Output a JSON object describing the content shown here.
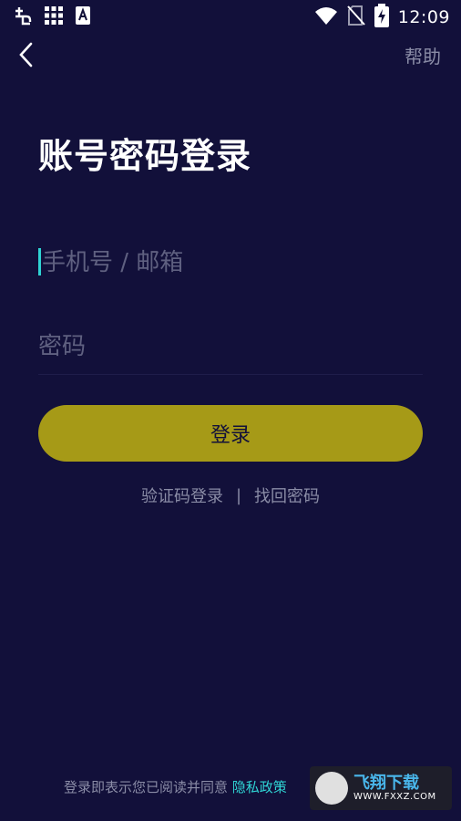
{
  "status_bar": {
    "time": "12:09",
    "icons": [
      "app-notification-icon",
      "grid-icon",
      "font-icon",
      "wifi-icon",
      "no-sim-icon",
      "battery-charging-icon"
    ]
  },
  "nav": {
    "back_icon": "chevron-left-icon",
    "help_label": "帮助"
  },
  "page": {
    "title": "账号密码登录"
  },
  "form": {
    "account_placeholder": "手机号 / 邮箱",
    "password_placeholder": "密码",
    "login_label": "登录"
  },
  "alt_links": {
    "sms_login": "验证码登录",
    "separator": "|",
    "recover_password": "找回密码"
  },
  "footer": {
    "agreement_text": "登录即表示您已阅读并同意",
    "privacy_link": "隐私政策"
  },
  "watermark": {
    "title": "飞翔下载",
    "url": "WWW.FXXZ.COM"
  },
  "colors": {
    "background": "#12103a",
    "accent": "#2fd3d3",
    "button": "#a69a17",
    "muted_text": "#8a8ca6",
    "placeholder": "#5f6080"
  }
}
